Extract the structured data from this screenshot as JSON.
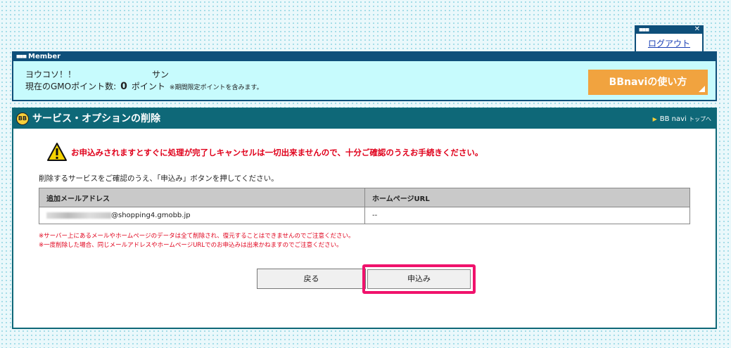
{
  "logout": {
    "label": "ログアウト"
  },
  "member": {
    "bar_label": "Member",
    "greeting": "ヨウコソ！！",
    "honorific": "サン",
    "points_label": "現在のGMOポイント数:",
    "points_value": "0",
    "points_unit": "ポイント",
    "points_note": "※期間限定ポイントを含みます。",
    "bbnavi_button": "BBnaviの使い方"
  },
  "panel": {
    "title": "サービス・オプションの削除",
    "top_link_main": "BB navi",
    "top_link_sub": "トップへ",
    "warning": "お申込みされますとすぐに処理が完了しキャンセルは一切出来ませんので、十分ご確認のうえお手続きください。",
    "instruction": "削除するサービスをご確認のうえ、「申込み」ボタンを押してください。",
    "table": {
      "headers": [
        "追加メールアドレス",
        "ホームページURL"
      ],
      "rows": [
        {
          "email_domain": "@shopping4.gmobb.jp",
          "url": "--"
        }
      ]
    },
    "notes": [
      "※サーバー上にあるメールやホームページのデータは全て削除され、復元することはできませんのでご注意ください。",
      "※一度削除した場合、同じメールアドレスやホームページURLでのお申込みは出来かねますのでご注意ください。"
    ],
    "back_button": "戻る",
    "apply_button": "申込み"
  },
  "colors": {
    "member_bg": "#c7fbfd",
    "header_dark": "#0e4f7a",
    "panel_header": "#0e6878",
    "warning_red": "#e0001b",
    "bbnavi_orange": "#f1a33f",
    "highlight_pink": "#f0126c"
  }
}
